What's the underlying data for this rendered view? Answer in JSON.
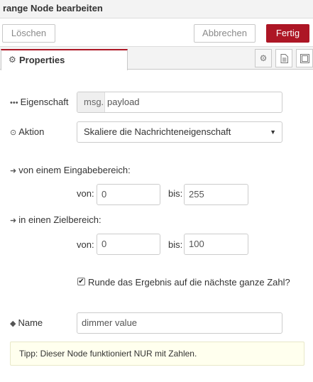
{
  "window": {
    "title": "range Node bearbeiten"
  },
  "toolbar": {
    "delete_label": "Löschen",
    "cancel_label": "Abbrechen",
    "done_label": "Fertig"
  },
  "tabs": {
    "properties_label": "Properties"
  },
  "icons": {
    "properties_tab": "gear-icon",
    "settings_tab": "gear-icon",
    "description_tab": "file-text-icon",
    "appearance_tab": "window-icon"
  },
  "colors": {
    "primary": "#ad1625",
    "tip_background": "#ffffee"
  },
  "form": {
    "property": {
      "label": "Eigenschaft",
      "prefix": "msg.",
      "value": "payload"
    },
    "action": {
      "label": "Aktion",
      "value": "Skaliere die Nachrichteneigenschaft"
    },
    "input_range": {
      "label": "von einem Eingabebereich:",
      "from_label": "von:",
      "from_value": "0",
      "to_label": "bis:",
      "to_value": "255"
    },
    "target_range": {
      "label": "in einen Zielbereich:",
      "from_label": "von:",
      "from_value": "0",
      "to_label": "bis:",
      "to_value": "100"
    },
    "round": {
      "label": "Runde das Ergebnis auf die nächste ganze Zahl?",
      "checked": true
    },
    "name": {
      "label": "Name",
      "value": "dimmer value"
    }
  },
  "tip": "Tipp: Dieser Node funktioniert NUR mit Zahlen."
}
